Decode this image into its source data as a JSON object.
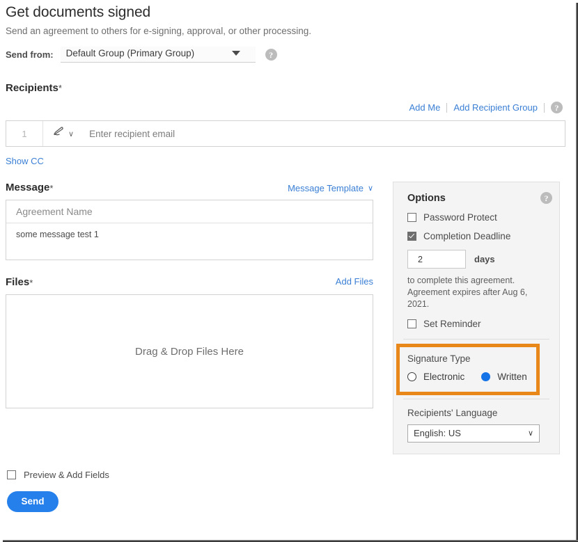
{
  "header": {
    "title": "Get documents signed",
    "subtitle": "Send an agreement to others for e-signing, approval, or other processing."
  },
  "send_from": {
    "label": "Send from:",
    "value": "Default Group (Primary Group)",
    "help_glyph": "?"
  },
  "recipients": {
    "heading": "Recipients",
    "required_mark": "*",
    "add_me_label": "Add Me",
    "add_recipient_group_label": "Add Recipient Group",
    "help_glyph": "?",
    "row": {
      "index": "1",
      "role_chevron": "∨",
      "email_placeholder": "Enter recipient email"
    },
    "show_cc_label": "Show CC"
  },
  "message": {
    "heading": "Message",
    "required_mark": "*",
    "template_link": "Message Template",
    "template_chevron": "∨",
    "agreement_name_placeholder": "Agreement Name",
    "body_value": "some message test 1"
  },
  "files": {
    "heading": "Files",
    "required_mark": "*",
    "add_files_label": "Add Files",
    "dropzone_text": "Drag & Drop Files Here"
  },
  "options": {
    "title": "Options",
    "help_glyph": "?",
    "password_protect_label": "Password Protect",
    "password_protect_checked": false,
    "completion_deadline_label": "Completion Deadline",
    "completion_deadline_checked": true,
    "days_value": "2",
    "days_unit": "days",
    "note_line_1": "to complete this agreement.",
    "note_line_2": "Agreement expires after Aug 6, 2021.",
    "set_reminder_label": "Set Reminder",
    "set_reminder_checked": false,
    "signature_type": {
      "title": "Signature Type",
      "electronic_label": "Electronic",
      "written_label": "Written",
      "selected": "Written",
      "highlight_color": "#e8871a"
    },
    "language": {
      "title": "Recipients' Language",
      "selected": "English: US",
      "caret": "∨"
    }
  },
  "footer": {
    "preview_label": "Preview & Add Fields",
    "preview_checked": false,
    "send_label": "Send",
    "send_color": "#2680eb"
  }
}
